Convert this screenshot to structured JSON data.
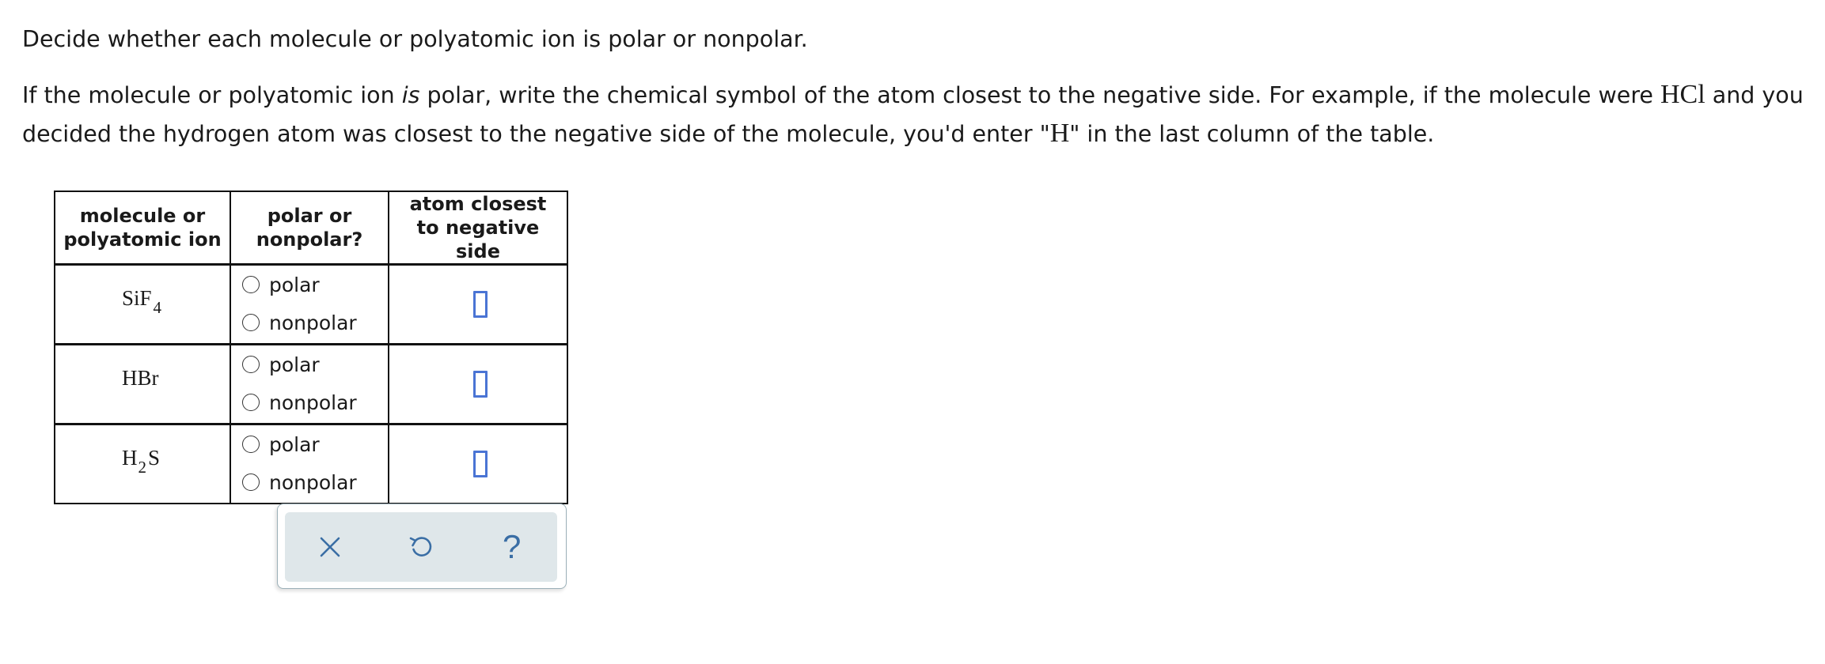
{
  "instructions": {
    "line1": "Decide whether each molecule or polyatomic ion is polar or nonpolar.",
    "p2_part1": "If the molecule or polyatomic ion ",
    "p2_italic": "is",
    "p2_part2": " polar, write the chemical symbol of the atom closest to the negative side. For example, if the molecule were ",
    "p2_example_formula": "HCl",
    "p2_part3": " and you decided the hydrogen atom was closest to the negative side of the molecule, you'd enter \"",
    "p2_example_symbol": "H",
    "p2_part4": "\" in the last column of the table."
  },
  "table": {
    "headers": [
      "molecule or polyatomic ion",
      "polar or nonpolar?",
      "atom closest to negative side"
    ],
    "option_polar": "polar",
    "option_nonpolar": "nonpolar",
    "rows": [
      {
        "formula_main": "SiF",
        "formula_sub": "4",
        "formula_tail": ""
      },
      {
        "formula_main": "HBr",
        "formula_sub": "",
        "formula_tail": ""
      },
      {
        "formula_main": "H",
        "formula_sub": "2",
        "formula_tail": "S"
      }
    ]
  },
  "toolbar": {
    "icons": [
      "close-icon",
      "undo-icon",
      "help-icon"
    ],
    "help_glyph": "?",
    "accent_color": "#3a6ea5",
    "answer_box_color": "#4a74d4"
  }
}
